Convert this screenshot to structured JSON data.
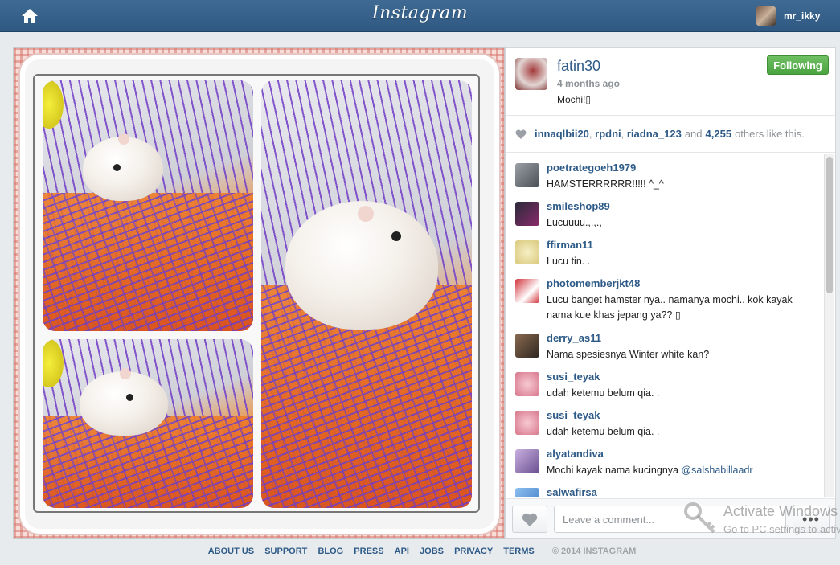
{
  "header": {
    "logo": "Instagram",
    "username": "mr_ikky",
    "home_icon": "home-icon"
  },
  "post": {
    "owner": "fatin30",
    "time": "4 months ago",
    "caption": "Mochi!▯",
    "follow_label": "Following",
    "likes": {
      "users": [
        "innaqlbii20",
        "rpdni",
        "riadna_123"
      ],
      "and": "and",
      "count": "4,255",
      "suffix": "others like this."
    }
  },
  "comments": [
    {
      "user": "poetrategoeh1979",
      "text": "HAMSTERRRRRR!!!!! ^_^",
      "avatar_color": "#6b6f74"
    },
    {
      "user": "smileshop89",
      "text": "Lucuuuu.,.,.,",
      "avatar_color": "#1d1d2b"
    },
    {
      "user": "ffirman11",
      "text": "Lucu tin. .",
      "avatar_color": "#e9dca0"
    },
    {
      "user": "photomemberjkt48",
      "text": "Lucu banget hamster nya.. namanya mochi.. kok kayak nama kue khas jepang ya?? ▯",
      "avatar_color": "#d0323a"
    },
    {
      "user": "derry_as11",
      "text": "Nama spesiesnya Winter white kan?",
      "avatar_color": "#5a4636"
    },
    {
      "user": "susi_teyak",
      "text": "udah ketemu belum qia. .",
      "avatar_color": "#e7a3b1"
    },
    {
      "user": "susi_teyak",
      "text": "udah ketemu belum qia. .",
      "avatar_color": "#e7a3b1"
    },
    {
      "user": "alyatandiva",
      "text": "Mochi kayak nama kucingnya ",
      "mention": "@salshabillaadr",
      "avatar_color": "#6a4f8f"
    },
    {
      "user": "salwafirsa",
      "text": "",
      "avatar_color": "#3a78c2"
    }
  ],
  "comment_box": {
    "placeholder": "Leave a comment...",
    "more_label": "•••"
  },
  "watermark": {
    "title": "Activate Windows",
    "subtitle": "Go to PC settings to activate"
  },
  "footer": {
    "links": [
      "ABOUT US",
      "SUPPORT",
      "BLOG",
      "PRESS",
      "API",
      "JOBS",
      "PRIVACY",
      "TERMS"
    ],
    "copyright": "© 2014 INSTAGRAM"
  },
  "colors": {
    "link": "#2d5a87",
    "follow": "#49a43f",
    "topbar": "#3f6a93"
  }
}
